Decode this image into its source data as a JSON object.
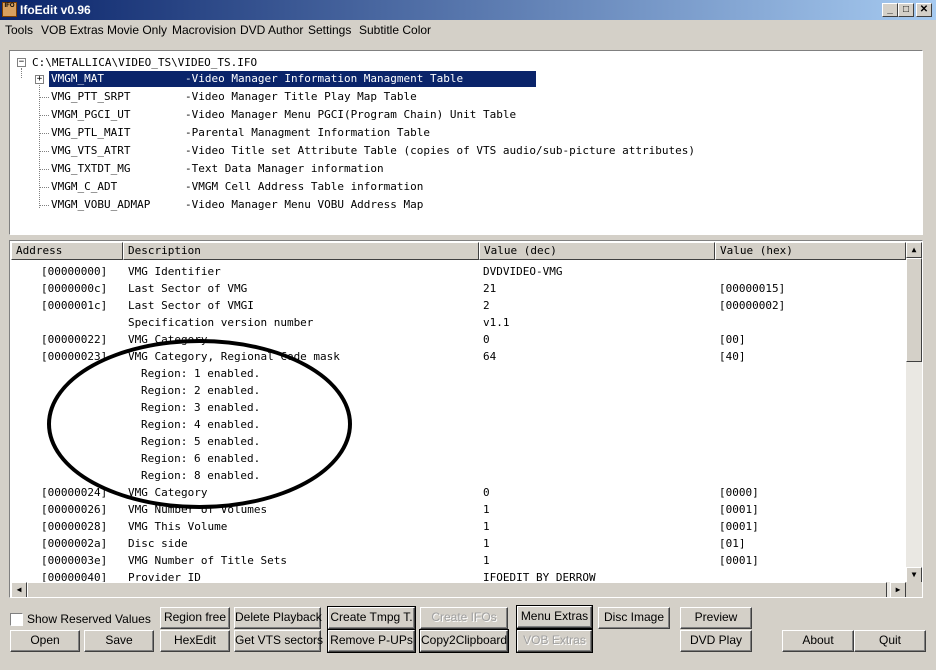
{
  "window": {
    "title": "IfoEdit v0.96",
    "icon_text": "IFO"
  },
  "title_buttons": {
    "minimize": "_",
    "maximize": "□",
    "close": "✕"
  },
  "menu": [
    "Tools",
    "VOB Extras",
    "Movie Only",
    "Macrovision",
    "DVD Author",
    "Settings",
    "Subtitle Color"
  ],
  "tree": {
    "root": "C:\\METALLICA\\VIDEO_TS\\VIDEO_TS.IFO",
    "items": [
      {
        "name": "VMGM_MAT",
        "desc": "-Video Manager Information Managment Table"
      },
      {
        "name": "VMG_PTT_SRPT",
        "desc": "-Video Manager Title Play Map Table"
      },
      {
        "name": "VMGM_PGCI_UT",
        "desc": "-Video Manager Menu PGCI(Program Chain) Unit Table"
      },
      {
        "name": "VMG_PTL_MAIT",
        "desc": "-Parental Managment Information Table"
      },
      {
        "name": "VMG_VTS_ATRT",
        "desc": "-Video Title set Attribute Table (copies of VTS audio/sub-picture attributes)"
      },
      {
        "name": "VMG_TXTDT_MG",
        "desc": "-Text Data Manager information"
      },
      {
        "name": "VMGM_C_ADT",
        "desc": "-VMGM Cell Address Table information"
      },
      {
        "name": "VMGM_VOBU_ADMAP",
        "desc": "-Video Manager Menu VOBU Address Map"
      }
    ]
  },
  "list": {
    "headers": [
      "Address",
      "Description",
      "Value (dec)",
      "Value (hex)"
    ],
    "rows": [
      {
        "addr": "[00000000]",
        "desc": "VMG Identifier",
        "dec": "DVDVIDEO-VMG",
        "hex": ""
      },
      {
        "addr": "[0000000c]",
        "desc": "Last Sector of VMG",
        "dec": "21",
        "hex": "[00000015]"
      },
      {
        "addr": "[0000001c]",
        "desc": "Last Sector of VMGI",
        "dec": "2",
        "hex": "[00000002]"
      },
      {
        "addr": "",
        "desc": "Specification version number",
        "dec": "v1.1",
        "hex": ""
      },
      {
        "addr": "[00000022]",
        "desc": "VMG Category",
        "dec": "0",
        "hex": "[00]"
      },
      {
        "addr": "[00000023]",
        "desc": "VMG Category, Regional Code mask",
        "dec": "64",
        "hex": "[40]"
      },
      {
        "addr": "",
        "sub": "Region: 1 enabled.",
        "dec": "",
        "hex": ""
      },
      {
        "addr": "",
        "sub": "Region: 2 enabled.",
        "dec": "",
        "hex": ""
      },
      {
        "addr": "",
        "sub": "Region: 3 enabled.",
        "dec": "",
        "hex": ""
      },
      {
        "addr": "",
        "sub": "Region: 4 enabled.",
        "dec": "",
        "hex": ""
      },
      {
        "addr": "",
        "sub": "Region: 5 enabled.",
        "dec": "",
        "hex": ""
      },
      {
        "addr": "",
        "sub": "Region: 6 enabled.",
        "dec": "",
        "hex": ""
      },
      {
        "addr": "",
        "sub": "Region: 8 enabled.",
        "dec": "",
        "hex": ""
      },
      {
        "addr": "[00000024]",
        "desc": "VMG Category",
        "dec": "0",
        "hex": "[0000]"
      },
      {
        "addr": "[00000026]",
        "desc": "VMG Number of Volumes",
        "dec": "1",
        "hex": "[0001]"
      },
      {
        "addr": "[00000028]",
        "desc": "VMG This Volume",
        "dec": "1",
        "hex": "[0001]"
      },
      {
        "addr": "[0000002a]",
        "desc": "Disc side",
        "dec": "1",
        "hex": "[01]"
      },
      {
        "addr": "[0000003e]",
        "desc": "VMG Number of Title Sets",
        "dec": "1",
        "hex": "[0001]"
      },
      {
        "addr": "[00000040]",
        "desc": "Provider ID",
        "dec": "IFOEDIT BY DERROW",
        "hex": ""
      }
    ]
  },
  "scroll": {
    "up": "▲",
    "down": "▼",
    "left": "◀",
    "right": "▶"
  },
  "controls": {
    "show_reserved": "Show Reserved Values",
    "region_free": "Region free",
    "delete_playback": "Delete Playback",
    "create_tmpg": "Create Tmpg T.",
    "create_ifos": "Create IFOs",
    "menu_extras": "Menu Extras",
    "disc_image": "Disc Image",
    "preview": "Preview",
    "open": "Open",
    "save": "Save",
    "hexedit": "HexEdit",
    "get_vts_sectors": "Get VTS sectors",
    "remove_pups": "Remove P-UPs",
    "copy2clipboard": "Copy2Clipboard",
    "vob_extras": "VOB Extras",
    "dvd_play": "DVD Play",
    "about": "About",
    "quit": "Quit"
  },
  "colors": {
    "selection": "#0a246a",
    "face": "#d4d0c8",
    "annotation": "#000000"
  }
}
